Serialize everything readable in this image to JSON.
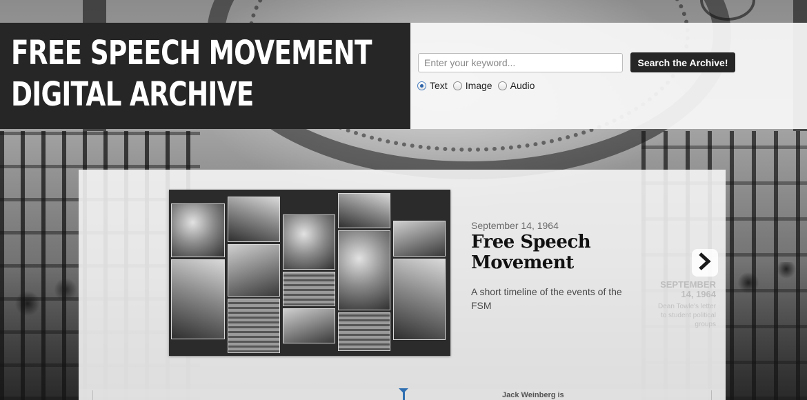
{
  "header": {
    "title_lines": [
      "FREE SPEECH MOVEMENT",
      "DIGITAL ARCHIVE"
    ]
  },
  "search": {
    "placeholder": "Enter your keyword...",
    "value": "",
    "button_label": "Search the Archive!",
    "types": [
      {
        "label": "Text",
        "checked": true
      },
      {
        "label": "Image",
        "checked": false
      },
      {
        "label": "Audio",
        "checked": false
      }
    ]
  },
  "slide": {
    "date": "September 14, 1964",
    "title": "Free Speech Movement",
    "description": "A short timeline of the events of the FSM",
    "next_icon": "chevron-right-icon"
  },
  "next_slide": {
    "date_lines": [
      "SEPTEMBER",
      "14, 1964"
    ],
    "text": "Dean Towle's letter to student political groups"
  },
  "timeline": {
    "event_label": "Jack Weinberg is"
  },
  "colors": {
    "header_bg": "#262626",
    "accent_blue": "#2f6fb1",
    "button_bg": "#262626"
  }
}
